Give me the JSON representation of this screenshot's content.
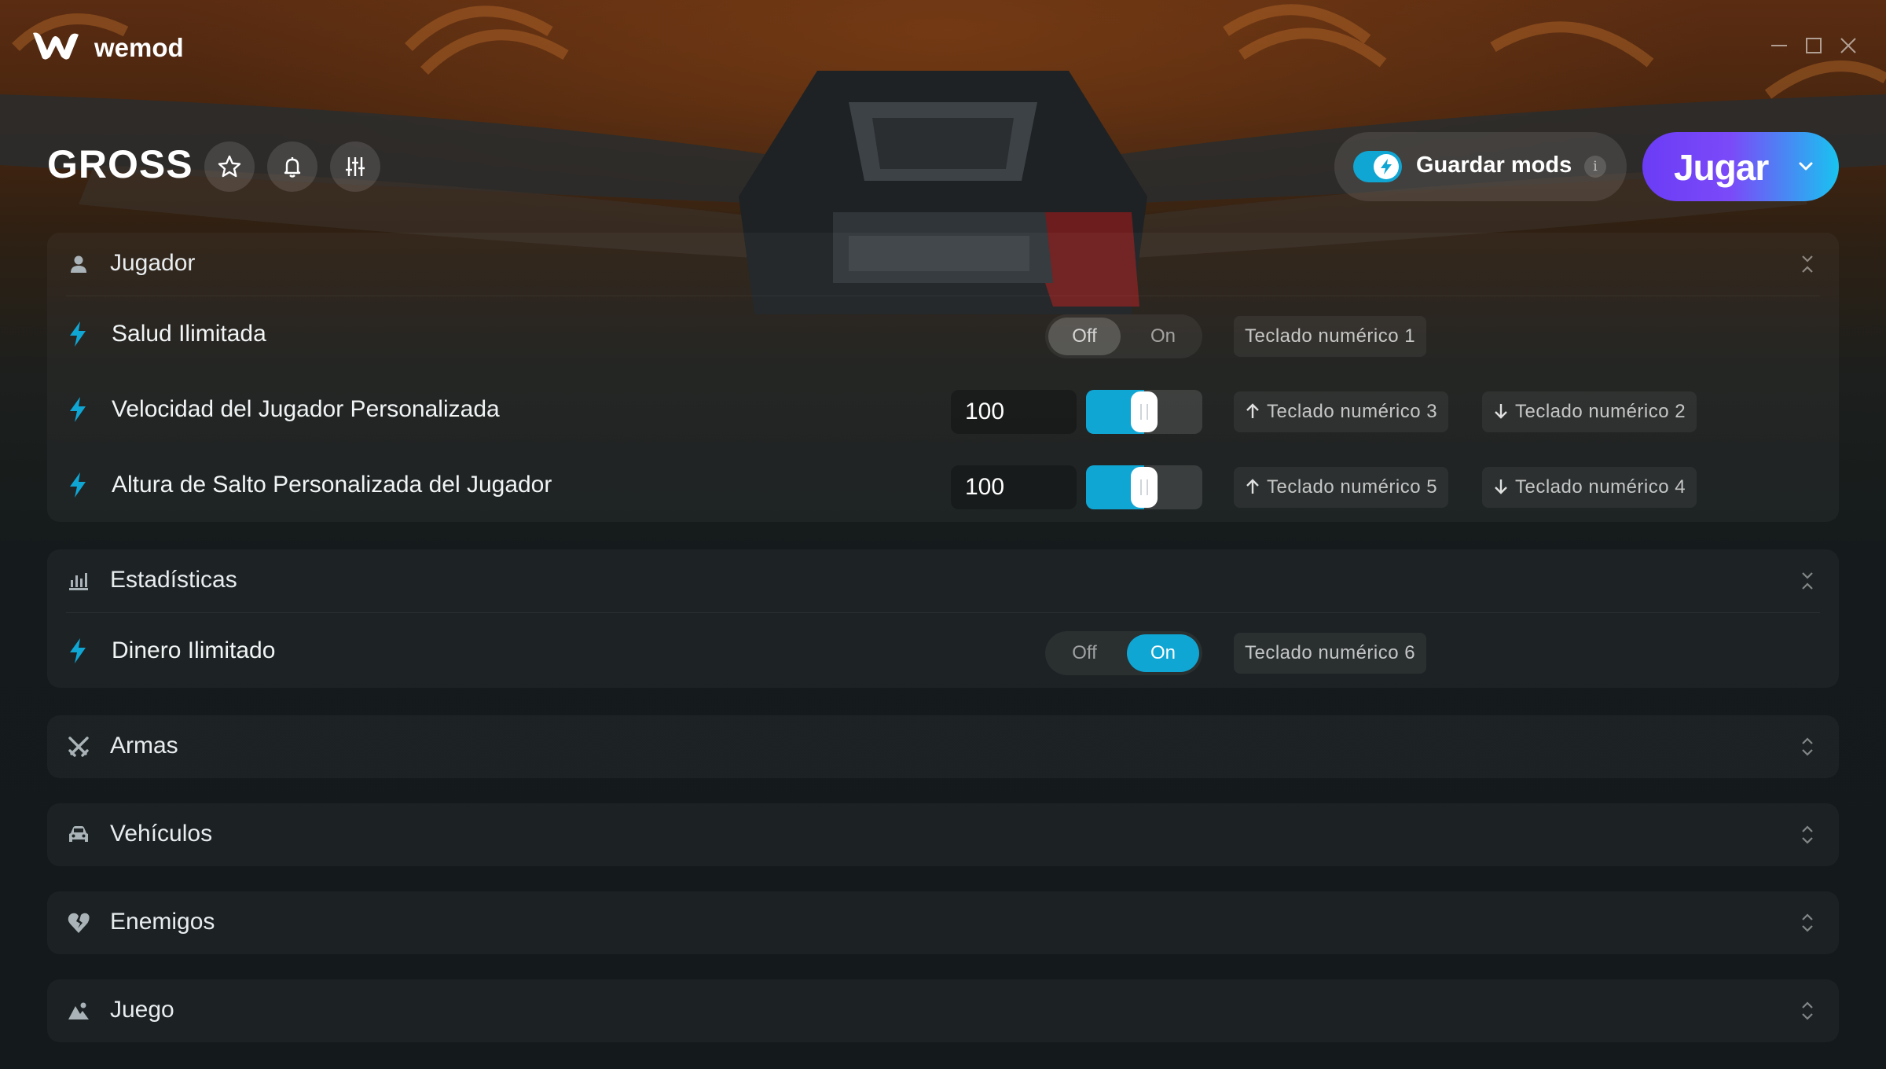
{
  "app": {
    "brand": "wemod"
  },
  "header": {
    "game_title": "GROSS",
    "save_mods_label": "Guardar mods",
    "save_mods_enabled": true,
    "info_label": "i",
    "play_label": "Jugar"
  },
  "colors": {
    "accent": "#10a6d4",
    "play_start": "#6a3cf5",
    "play_end": "#19c3f0"
  },
  "sections": {
    "player": {
      "title": "Jugador",
      "icon": "person-icon",
      "expanded": true,
      "mods": {
        "unlimited_health": {
          "label": "Salud Ilimitada",
          "state": "Off",
          "off_label": "Off",
          "on_label": "On",
          "key": "Teclado numérico 1"
        },
        "player_speed": {
          "label": "Velocidad del Jugador Personalizada",
          "value": "100",
          "slider_fraction": 0.5,
          "key_up": "Teclado numérico 3",
          "key_down": "Teclado numérico 2"
        },
        "jump_height": {
          "label": "Altura de Salto Personalizada del Jugador",
          "value": "100",
          "slider_fraction": 0.5,
          "key_up": "Teclado numérico 5",
          "key_down": "Teclado numérico 4"
        }
      }
    },
    "stats": {
      "title": "Estadísticas",
      "icon": "bar-chart-icon",
      "expanded": true,
      "mods": {
        "unlimited_money": {
          "label": "Dinero Ilimitado",
          "state": "On",
          "off_label": "Off",
          "on_label": "On",
          "key": "Teclado numérico 6"
        }
      }
    },
    "weapons": {
      "title": "Armas",
      "icon": "crossed-swords-icon",
      "expanded": false
    },
    "vehicles": {
      "title": "Vehículos",
      "icon": "car-icon",
      "expanded": false
    },
    "enemies": {
      "title": "Enemigos",
      "icon": "broken-heart-icon",
      "expanded": false
    },
    "game": {
      "title": "Juego",
      "icon": "landscape-icon",
      "expanded": false
    }
  }
}
